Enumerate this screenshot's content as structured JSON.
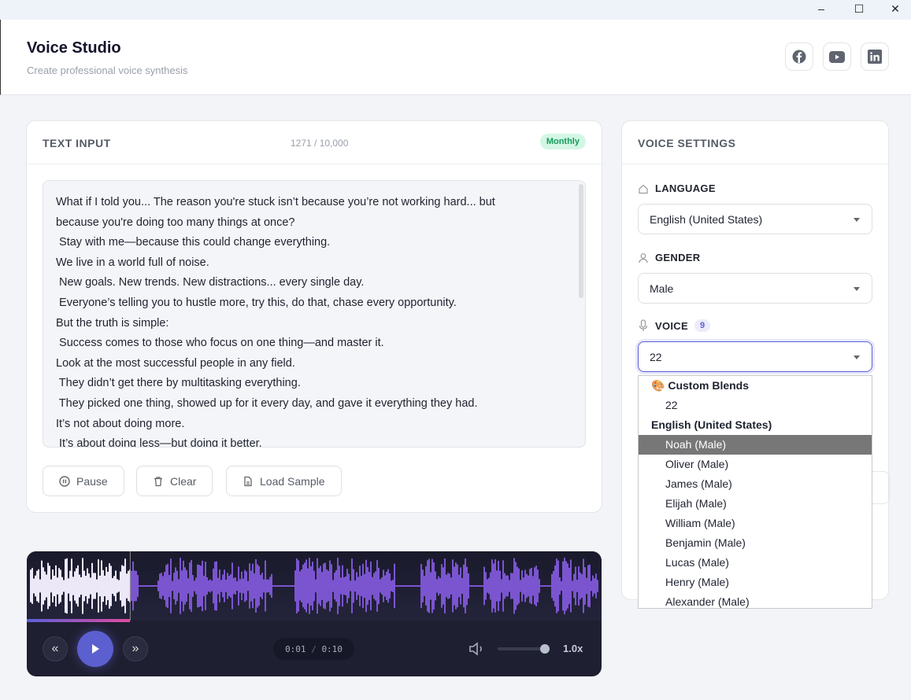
{
  "window": {
    "minimize": "–",
    "maximize": "☐",
    "close": "✕"
  },
  "header": {
    "title": "Voice Studio",
    "subtitle": "Create professional voice synthesis",
    "social": [
      "facebook",
      "youtube",
      "linkedin"
    ]
  },
  "text_input": {
    "title": "TEXT INPUT",
    "count": "1271 / 10,000",
    "badge": "Monthly",
    "text": "What if I told you... The reason you're stuck isn’t because you’re not working hard... but\nbecause you're doing too many things at once?\n Stay with me—because this could change everything.\nWe live in a world full of noise.\n New goals. New trends. New distractions... every single day.\n Everyone’s telling you to hustle more, try this, do that, chase every opportunity.\nBut the truth is simple:\n Success comes to those who focus on one thing—and master it.\nLook at the most successful people in any field.\n They didn’t get there by multitasking everything.\n They picked one thing, showed up for it every day, and gave it everything they had.\nIt’s not about doing more.\n It’s about doing less—but doing it better.",
    "buttons": {
      "pause": "Pause",
      "clear": "Clear",
      "load_sample": "Load Sample"
    }
  },
  "player": {
    "current": "0:01",
    "separator": "/",
    "duration": "0:10",
    "speed": "1.0x",
    "progress": 0.18,
    "volume": 0.9,
    "colors": {
      "played": "#ece8f7",
      "unplayed": "#7b55d0"
    }
  },
  "settings": {
    "title": "VOICE SETTINGS",
    "language": {
      "label": "LANGUAGE",
      "value": "English (United States)"
    },
    "gender": {
      "label": "GENDER",
      "value": "Male"
    },
    "voice": {
      "label": "VOICE",
      "count": "9",
      "value": "22"
    },
    "dropdown": {
      "group1": "Custom Blends",
      "group1_items": [
        "22"
      ],
      "group2": "English (United States)",
      "items": [
        "Noah (Male)",
        "Oliver (Male)",
        "James (Male)",
        "Elijah (Male)",
        "William (Male)",
        "Benjamin (Male)",
        "Lucas (Male)",
        "Henry (Male)",
        "Alexander (Male)"
      ],
      "highlighted": "Noah (Male)"
    }
  }
}
